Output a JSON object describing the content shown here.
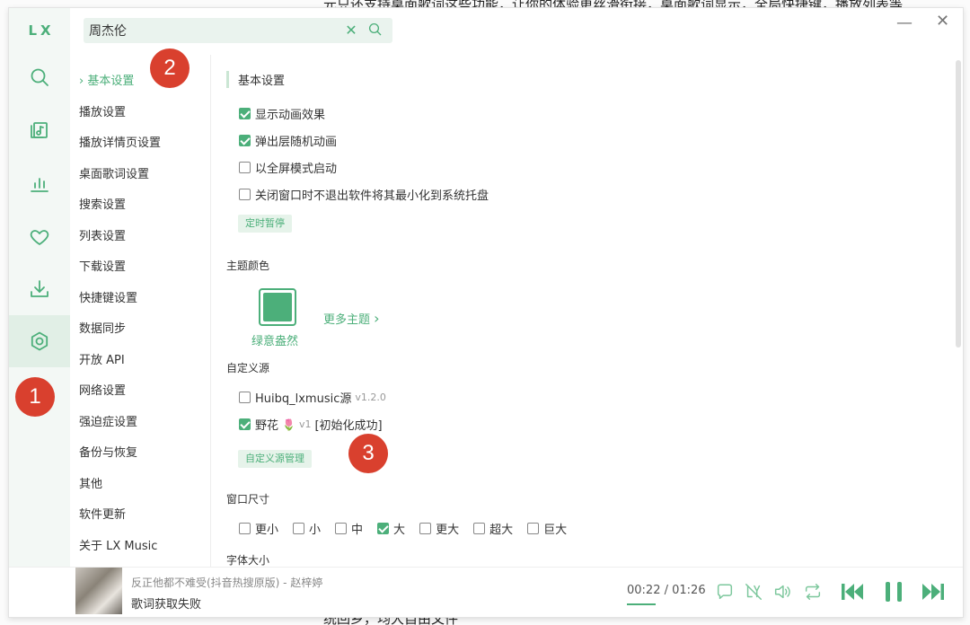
{
  "background": {
    "top_text": "元只还支持桌面歌词这些功能，让你的体验更丝滑衔接，桌面歌词显示，全局快捷键，播放列表等",
    "bottom_text": "统回乡，均大自由文件"
  },
  "app": {
    "logo": "LX"
  },
  "sidebar": {
    "icons": [
      "search-icon",
      "music-list-icon",
      "chart-icon",
      "heart-icon",
      "download-icon",
      "settings-icon"
    ],
    "active": "settings-icon"
  },
  "search": {
    "value": "周杰伦",
    "clear": "✕"
  },
  "window": {
    "minimize": "—",
    "close": "✕"
  },
  "badges": [
    "1",
    "2",
    "3"
  ],
  "menu": {
    "items": [
      "基本设置",
      "播放设置",
      "播放详情页设置",
      "桌面歌词设置",
      "搜索设置",
      "列表设置",
      "下载设置",
      "快捷键设置",
      "数据同步",
      "开放 API",
      "网络设置",
      "强迫症设置",
      "备份与恢复",
      "其他",
      "软件更新",
      "关于 LX Music"
    ],
    "active_prefix": "›"
  },
  "settings": {
    "section_title": "基本设置",
    "options": [
      {
        "label": "显示动画效果",
        "checked": true
      },
      {
        "label": "弹出层随机动画",
        "checked": true
      },
      {
        "label": "以全屏模式启动",
        "checked": false
      },
      {
        "label": "关闭窗口时不退出软件将其最小化到系统托盘",
        "checked": false
      }
    ],
    "timer_button": "定时暂停",
    "theme_label": "主题颜色",
    "theme_name": "绿意盎然",
    "more_themes": "更多主题",
    "theme_color": "#4caf7a",
    "custom_source_label": "自定义源",
    "sources": [
      {
        "name": "Huibq_lxmusic源",
        "version": "v1.2.0",
        "checked": false
      },
      {
        "name": "野花",
        "emoji": "🌷",
        "version": "v1",
        "status": "[初始化成功]",
        "checked": true
      }
    ],
    "source_manage_button": "自定义源管理",
    "window_size_label": "窗口尺寸",
    "window_sizes": [
      {
        "label": "更小",
        "checked": false
      },
      {
        "label": "小",
        "checked": false
      },
      {
        "label": "中",
        "checked": false
      },
      {
        "label": "大",
        "checked": true
      },
      {
        "label": "更大",
        "checked": false
      },
      {
        "label": "超大",
        "checked": false
      },
      {
        "label": "巨大",
        "checked": false
      }
    ],
    "font_size_label": "字体大小"
  },
  "player": {
    "song": "反正他都不难受(抖音热搜原版) - 赵梓婷",
    "lyric": "歌词获取失败",
    "time_current": "00:22",
    "time_separator": " / ",
    "time_total": "01:26"
  },
  "colors": {
    "accent": "#4caf7a",
    "badge": "#d9402e"
  }
}
